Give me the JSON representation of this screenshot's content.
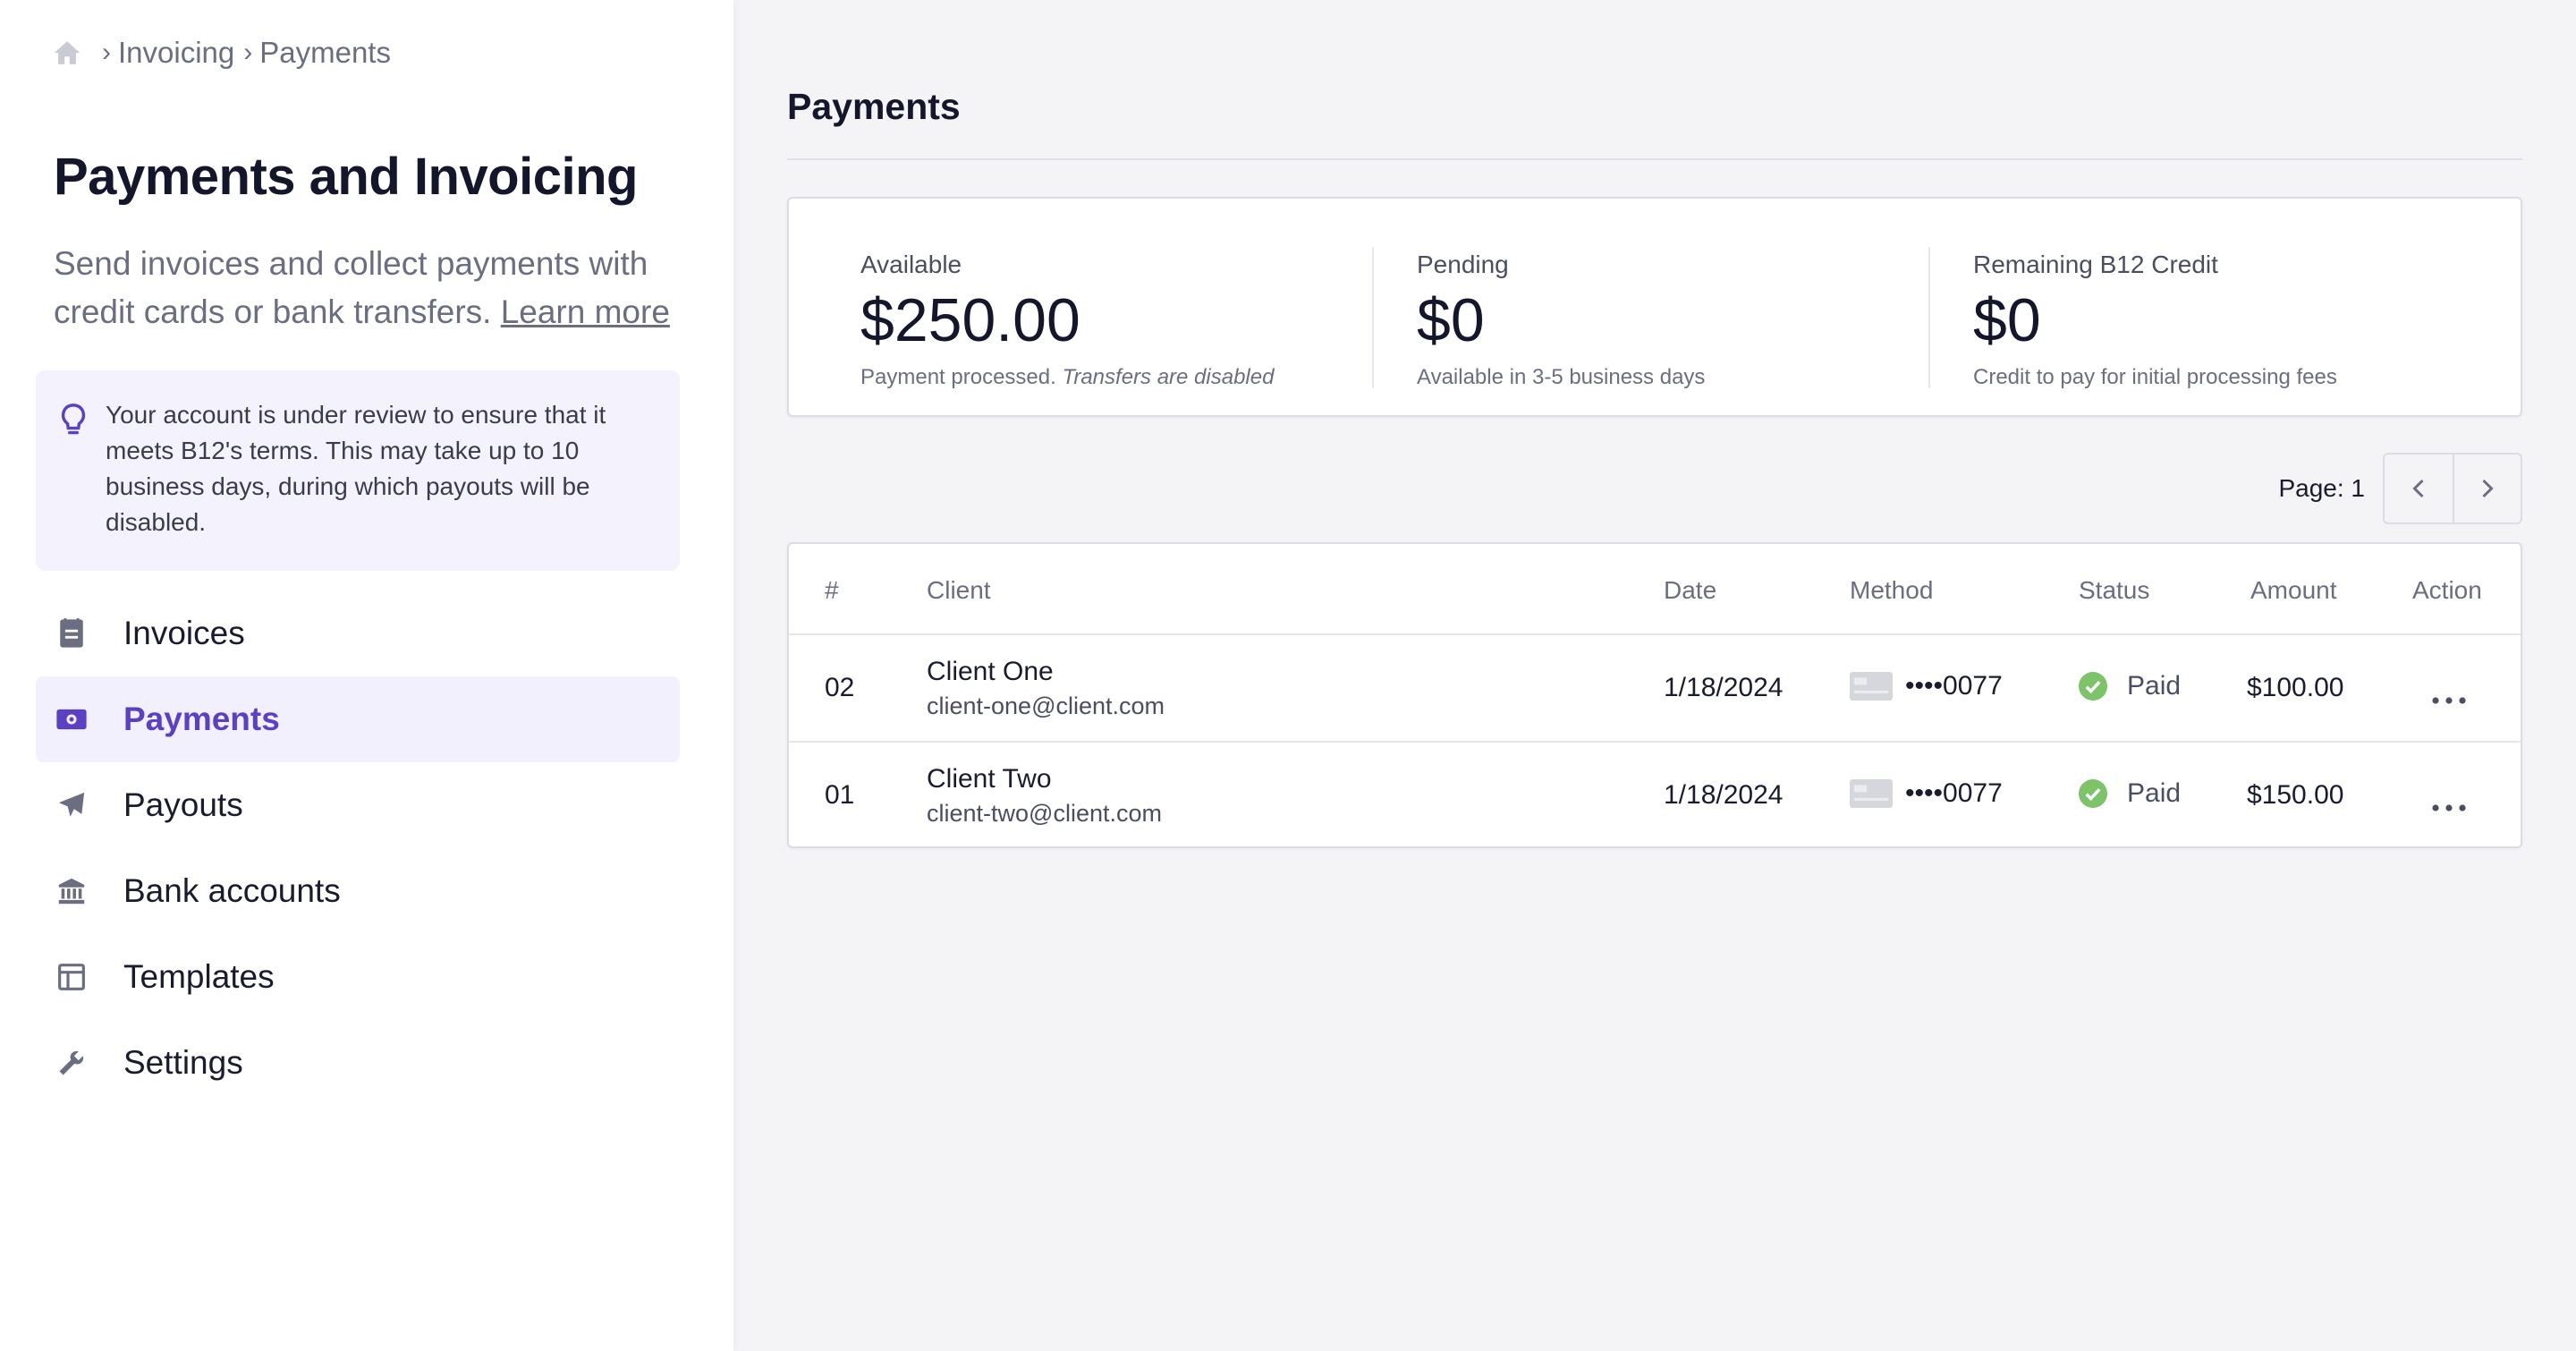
{
  "breadcrumb": {
    "items": [
      "Invoicing",
      "Payments"
    ],
    "separator": "›"
  },
  "sidebar": {
    "title": "Payments and Invoicing",
    "description": "Send invoices and collect payments with credit cards or bank transfers.",
    "learn_more": "Learn more",
    "notice": "Your account is under review to ensure that it meets B12's terms. This may take up to 10 business days, during which payouts will be disabled.",
    "items": [
      {
        "label": "Invoices",
        "icon": "invoice-icon"
      },
      {
        "label": "Payments",
        "icon": "payments-icon",
        "active": true
      },
      {
        "label": "Payouts",
        "icon": "paper-plane-icon"
      },
      {
        "label": "Bank accounts",
        "icon": "bank-icon"
      },
      {
        "label": "Templates",
        "icon": "template-icon"
      },
      {
        "label": "Settings",
        "icon": "wrench-icon"
      }
    ]
  },
  "main": {
    "title": "Payments",
    "summary": {
      "available": {
        "label": "Available",
        "value": "$250.00",
        "sub": "Payment processed.",
        "sub_em": "Transfers are disabled"
      },
      "pending": {
        "label": "Pending",
        "value": "$0",
        "sub": "Available in 3-5 business days"
      },
      "credit": {
        "label": "Remaining B12 Credit",
        "value": "$0",
        "sub": "Credit to pay for initial processing fees"
      }
    },
    "pager": {
      "label": "Page: 1"
    },
    "table": {
      "columns": [
        "#",
        "Client",
        "Date",
        "Method",
        "Status",
        "Amount",
        "Action"
      ],
      "rows": [
        {
          "num": "02",
          "client": "Client One",
          "email": "client-one@client.com",
          "date": "1/18/2024",
          "method": "••••0077",
          "status": "Paid",
          "amount": "$100.00"
        },
        {
          "num": "01",
          "client": "Client Two",
          "email": "client-two@client.com",
          "date": "1/18/2024",
          "method": "••••0077",
          "status": "Paid",
          "amount": "$150.00"
        }
      ]
    }
  },
  "colors": {
    "accent": "#5b3fc4",
    "success": "#7cc36a",
    "active_bg": "#f1f0fc"
  }
}
